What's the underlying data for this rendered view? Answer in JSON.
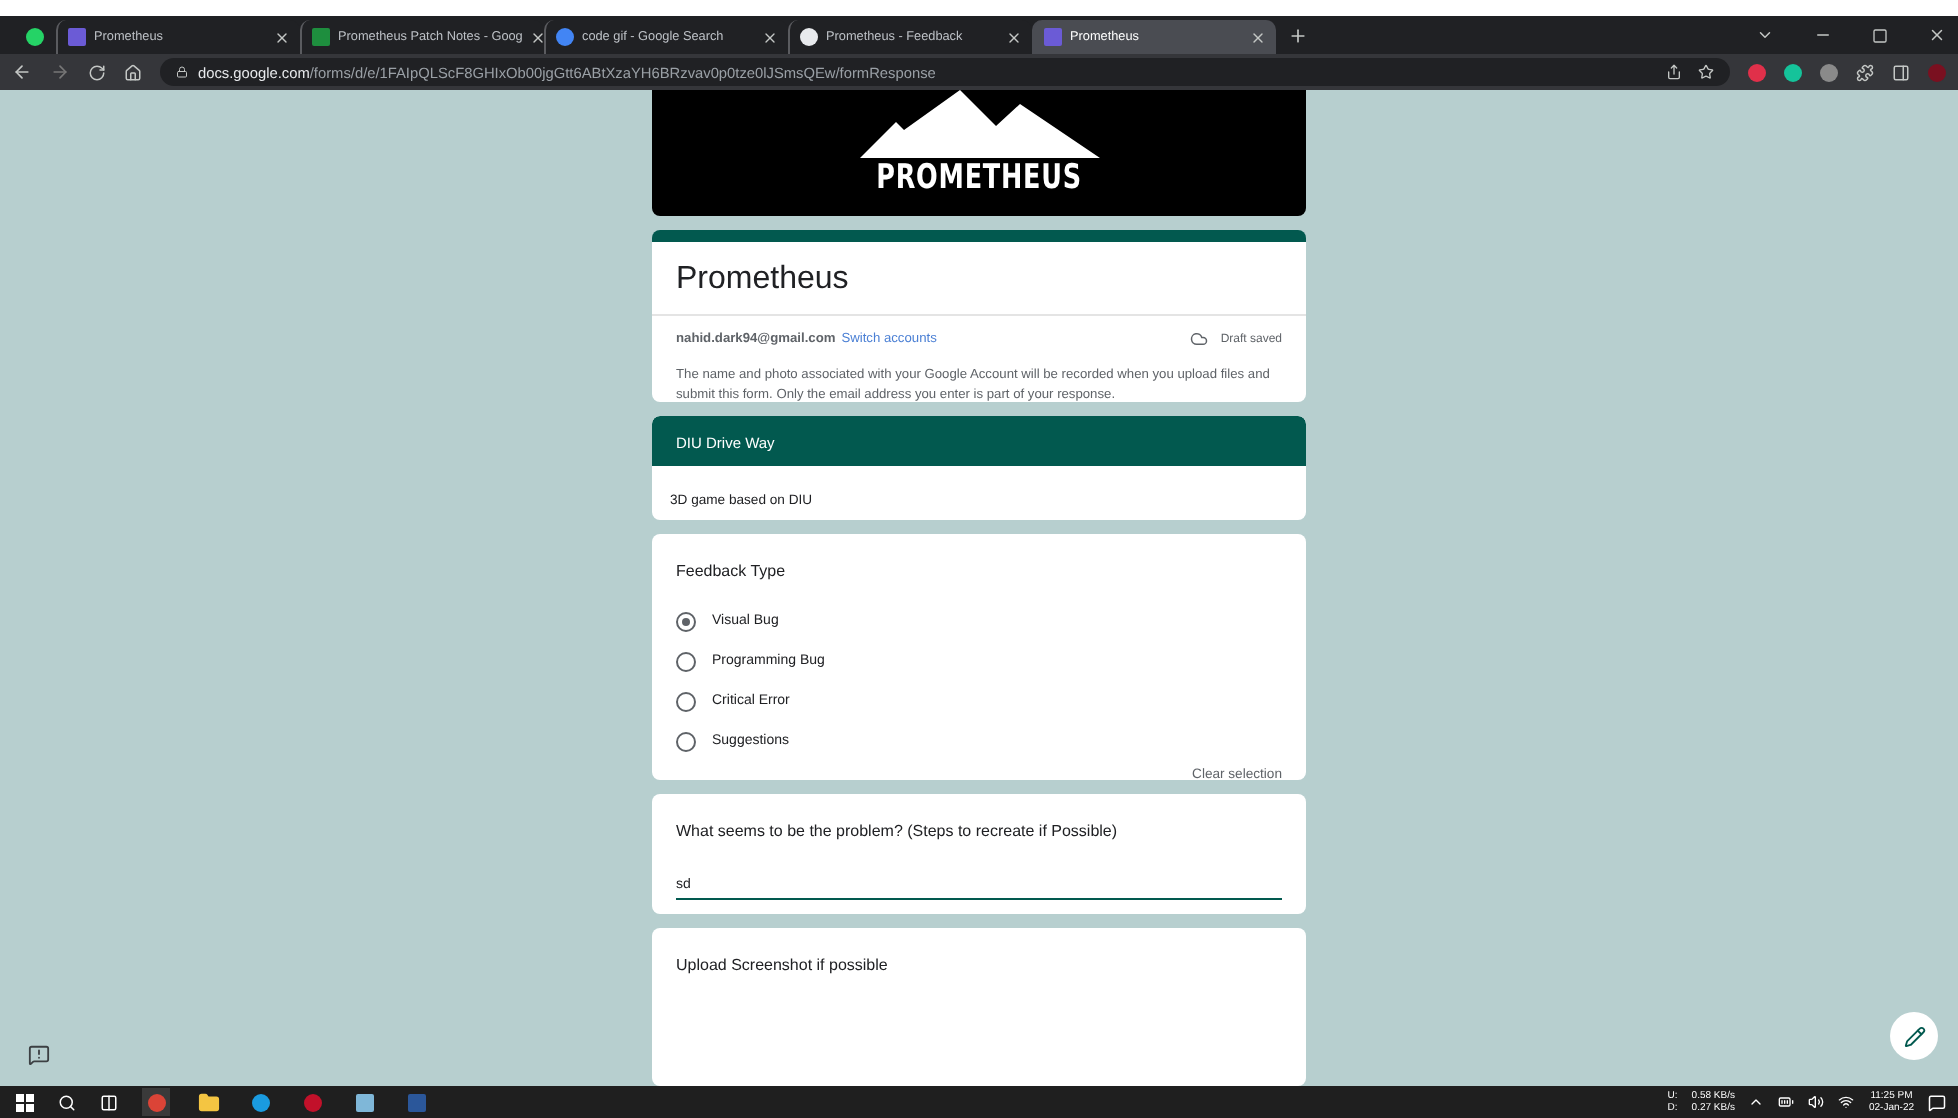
{
  "browser": {
    "tabs": [
      {
        "kind": "pinned",
        "selected": false
      },
      {
        "kind": "tab",
        "label": "Prometheus",
        "selected": false
      },
      {
        "kind": "tab",
        "label": "Prometheus Patch Notes - Goog",
        "selected": false
      },
      {
        "kind": "tab",
        "label": "code gif - Google Search",
        "selected": false
      },
      {
        "kind": "tab",
        "label": "Prometheus - Feedback",
        "selected": false
      },
      {
        "kind": "tab",
        "label": "Prometheus",
        "selected": true
      }
    ],
    "url_host": "docs.google.com",
    "url_path": "/forms/d/e/1FAIpQLScF8GHIxOb00jgGtt6ABtXzaYH6BRzvav0p0tze0lJSmsQEw/formResponse"
  },
  "form": {
    "banner_text": "PROMETHEUS",
    "title": "Prometheus",
    "email": "nahid.dark94@gmail.com",
    "switch_link": "Switch accounts",
    "draft_status": "Draft saved",
    "notice": "The name and photo associated with your Google Account will be recorded when you upload files and submit this form. Only the email address you enter is part of your response.",
    "section": {
      "title": "DIU Drive Way",
      "description": "3D game based on DIU"
    },
    "questions": [
      {
        "kind": "radio",
        "title": "Feedback Type",
        "options": [
          {
            "label": "Visual Bug",
            "selected": true
          },
          {
            "label": "Programming Bug",
            "selected": false
          },
          {
            "label": "Critical Error",
            "selected": false
          },
          {
            "label": "Suggestions",
            "selected": false
          }
        ],
        "clear_label": "Clear selection"
      },
      {
        "kind": "text",
        "title": "What seems to be the problem? (Steps to recreate if Possible)",
        "value": "sd"
      },
      {
        "kind": "upload",
        "title": "Upload Screenshot if possible"
      }
    ]
  },
  "taskbar": {
    "upload_label": "U:",
    "download_label": "D:",
    "upload_speed": "0.58 KB/s",
    "download_speed": "0.27 KB/s",
    "time": "11:25 PM",
    "date": "02-Jan-22"
  }
}
